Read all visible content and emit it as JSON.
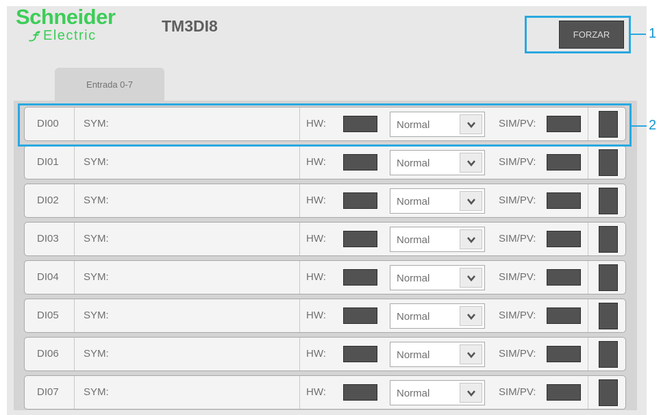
{
  "brand": {
    "line1": "Schneider",
    "line2": "Electric"
  },
  "module_title": "TM3DI8",
  "force_button_label": "FORZAR",
  "callouts": {
    "force": "1",
    "row": "2"
  },
  "tab_label": "Entrada 0-7",
  "labels": {
    "sym": "SYM:",
    "hw": "HW:",
    "sim": "SIM/PV:"
  },
  "rows": [
    {
      "id": "DI00",
      "mode": "Normal"
    },
    {
      "id": "DI01",
      "mode": "Normal"
    },
    {
      "id": "DI02",
      "mode": "Normal"
    },
    {
      "id": "DI03",
      "mode": "Normal"
    },
    {
      "id": "DI04",
      "mode": "Normal"
    },
    {
      "id": "DI05",
      "mode": "Normal"
    },
    {
      "id": "DI06",
      "mode": "Normal"
    },
    {
      "id": "DI07",
      "mode": "Normal"
    }
  ],
  "colors": {
    "brand_green": "#3dcd58",
    "callout_blue": "#29a8e0",
    "indicator": "#525252"
  },
  "icons": {
    "dropdown": "chevron-down-icon",
    "logo_mark": "schneider-logo-mark-icon"
  }
}
